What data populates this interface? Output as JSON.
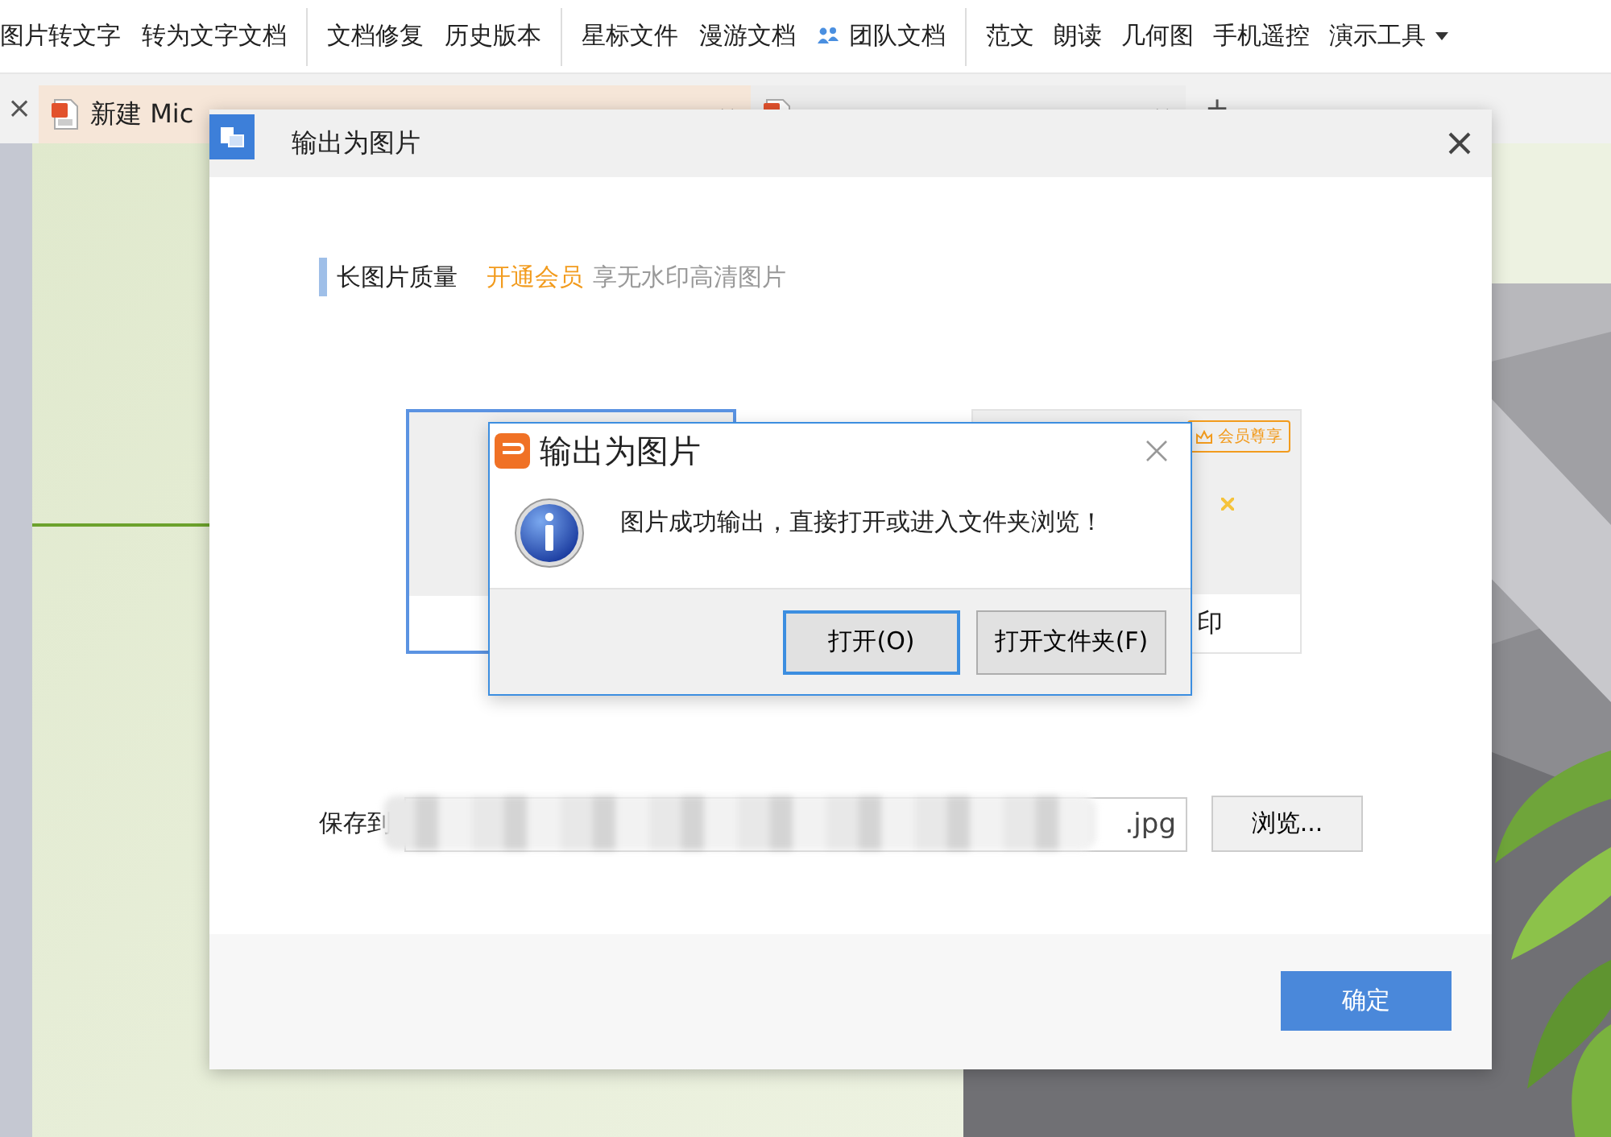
{
  "toolbar": {
    "groups": [
      {
        "items": [
          {
            "label": "图片转文字",
            "kind": "plain"
          },
          {
            "label": "转为文字文档",
            "kind": "plain"
          }
        ]
      },
      {
        "items": [
          {
            "label": "文档修复",
            "kind": "plain"
          },
          {
            "label": "历史版本",
            "kind": "plain"
          }
        ]
      },
      {
        "items": [
          {
            "label": "星标文件",
            "kind": "plain"
          },
          {
            "label": "漫游文档",
            "kind": "plain"
          },
          {
            "label": "团队文档",
            "kind": "team"
          }
        ]
      },
      {
        "items": [
          {
            "label": "范文",
            "kind": "plain"
          },
          {
            "label": "朗读",
            "kind": "plain"
          },
          {
            "label": "几何图",
            "kind": "plain"
          },
          {
            "label": "手机遥控",
            "kind": "plain"
          },
          {
            "label": "演示工具",
            "kind": "dropdown"
          }
        ]
      }
    ]
  },
  "tab_bar": {
    "close": "×",
    "tabs": [
      {
        "label": "新建 Mic",
        "selected": true
      },
      {
        "selected": false
      }
    ],
    "new_tab": "+"
  },
  "export_dialog": {
    "title": "输出为图片",
    "quality": {
      "label": "长图片质量",
      "promo": "开通会员",
      "promo_note": "享无水印高清图片"
    },
    "options": [
      {
        "selected": true
      },
      {
        "selected": false,
        "badge": "会员尊享",
        "label": "印"
      }
    ],
    "save": {
      "label": "保存到",
      "value": ".jpg",
      "browse": "浏览..."
    },
    "confirm": "确定"
  },
  "message_box": {
    "title": "输出为图片",
    "message": "图片成功输出，直接打开或进入文件夹浏览！",
    "buttons": [
      {
        "label": "打开(O)",
        "default": true
      },
      {
        "label": "打开文件夹(F)",
        "default": false
      }
    ]
  }
}
